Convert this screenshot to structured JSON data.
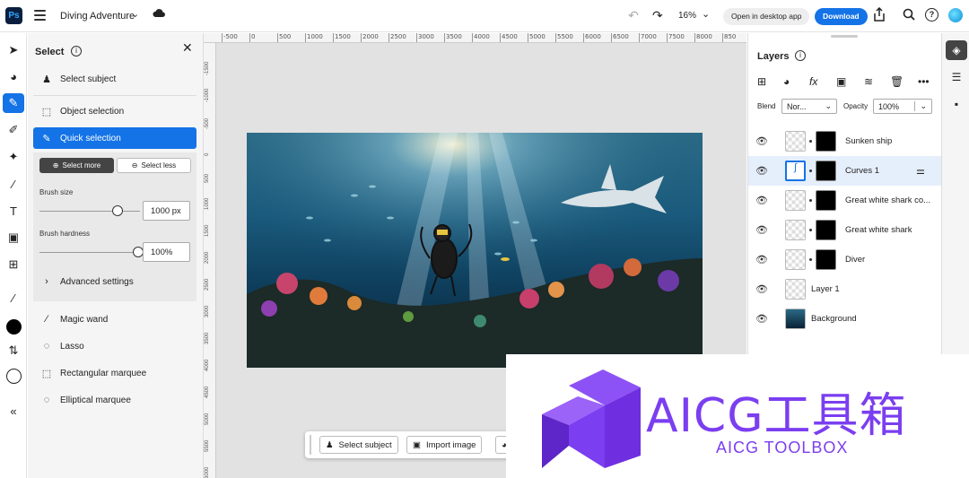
{
  "app": {
    "logo": "Ps",
    "doc_title": "Diving Adventure",
    "zoom": "16%"
  },
  "header": {
    "open_desktop": "Open in desktop app",
    "download": "Download"
  },
  "select_panel": {
    "title": "Select",
    "items": [
      {
        "label": "Select subject"
      },
      {
        "label": "Object selection"
      },
      {
        "label": "Quick selection"
      }
    ],
    "select_more": "Select more",
    "select_less": "Select less",
    "brush_size_label": "Brush size",
    "brush_size_value": "1000 px",
    "brush_size_level": 0.78,
    "brush_hardness_label": "Brush hardness",
    "brush_hardness_value": "100%",
    "brush_hardness_level": 1.0,
    "advanced": "Advanced settings",
    "tools": [
      {
        "label": "Magic wand"
      },
      {
        "label": "Lasso"
      },
      {
        "label": "Rectangular marquee"
      },
      {
        "label": "Elliptical marquee"
      }
    ]
  },
  "ruler": {
    "top": [
      "-500",
      "0",
      "500",
      "1000",
      "1500",
      "2000",
      "2500",
      "3000",
      "3500",
      "4000",
      "4500",
      "5000",
      "5500",
      "6000",
      "6500",
      "7000",
      "7500",
      "8000",
      "850"
    ],
    "left": [
      "-1500",
      "-1000",
      "-500",
      "0",
      "500",
      "1000",
      "1500",
      "2000",
      "2500",
      "3000",
      "3500",
      "4000",
      "4500",
      "5000",
      "5500",
      "6000"
    ]
  },
  "taskbar": {
    "select_subject": "Select subject",
    "import_image": "Import image"
  },
  "layers_panel": {
    "title": "Layers",
    "blend_label": "Blend",
    "blend_value": "Nor...",
    "opacity_label": "Opacity",
    "opacity_value": "100%",
    "layers": [
      {
        "name": "Sunken ship"
      },
      {
        "name": "Curves 1"
      },
      {
        "name": "Great white shark co..."
      },
      {
        "name": "Great white shark"
      },
      {
        "name": "Diver"
      },
      {
        "name": "Layer 1"
      },
      {
        "name": "Background"
      }
    ]
  },
  "watermark": {
    "cn": "AICG工具箱",
    "en": "AICG TOOLBOX"
  },
  "colors": {
    "accent": "#1473e6",
    "brand_purple": "#7b3ef0"
  }
}
